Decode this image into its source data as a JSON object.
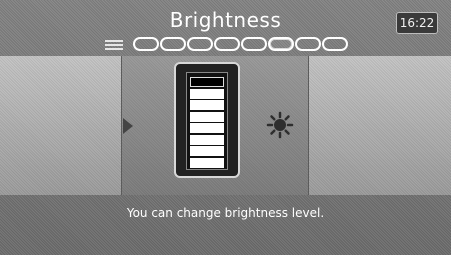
{
  "header": {
    "title": "Brightness",
    "clock": "16:22"
  },
  "pagination": {
    "pages": 8,
    "active_index": 5
  },
  "brightness": {
    "segments": 8,
    "level": 7
  },
  "hint": "You can change brightness level."
}
